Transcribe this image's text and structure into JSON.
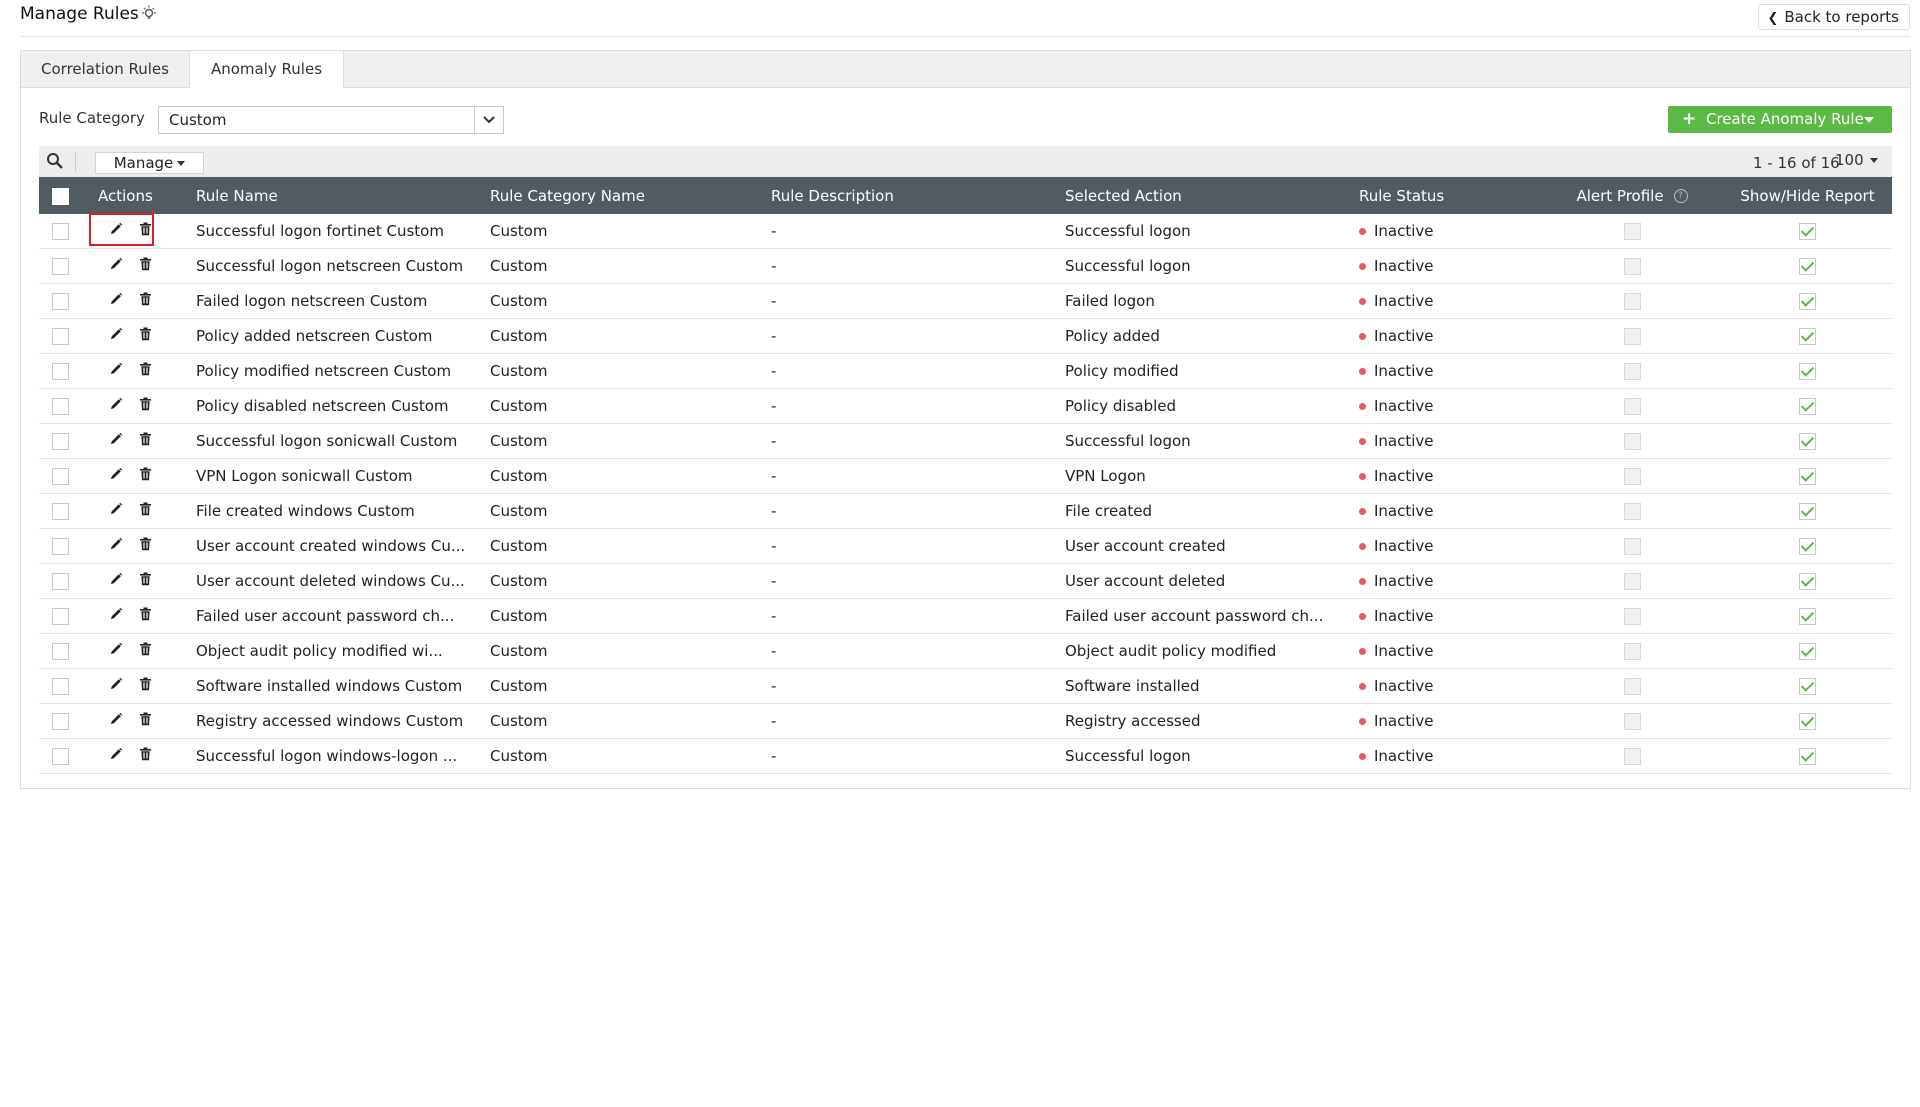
{
  "header": {
    "title": "Manage Rules",
    "bulb_icon": "lightbulb-icon",
    "back_label": "Back to reports"
  },
  "tabs": [
    {
      "label": "Correlation Rules",
      "active": false
    },
    {
      "label": "Anomaly Rules",
      "active": true
    }
  ],
  "filter": {
    "label": "Rule Category",
    "selected": "Custom"
  },
  "create_button": {
    "label": "Create Anomaly Rule",
    "color": "#5cb946"
  },
  "toolbar": {
    "manage_label": "Manage",
    "pager_text": "1 - 16 of 16",
    "per_page": "100"
  },
  "table": {
    "header_bg": "#515c62",
    "columns": [
      "Actions",
      "Rule Name",
      "Rule Category Name",
      "Rule Description",
      "Selected Action",
      "Rule Status",
      "Alert Profile",
      "Show/Hide Report"
    ],
    "rows": [
      {
        "name": "Successful logon fortinet Custom",
        "category": "Custom",
        "description": "-",
        "action": "Successful logon",
        "status": "Inactive"
      },
      {
        "name": "Successful logon netscreen Custom",
        "category": "Custom",
        "description": "-",
        "action": "Successful logon",
        "status": "Inactive"
      },
      {
        "name": "Failed logon netscreen Custom",
        "category": "Custom",
        "description": "-",
        "action": "Failed logon",
        "status": "Inactive"
      },
      {
        "name": "Policy added netscreen Custom",
        "category": "Custom",
        "description": "-",
        "action": "Policy added",
        "status": "Inactive"
      },
      {
        "name": "Policy modified netscreen Custom",
        "category": "Custom",
        "description": "-",
        "action": "Policy modified",
        "status": "Inactive"
      },
      {
        "name": "Policy disabled netscreen Custom",
        "category": "Custom",
        "description": "-",
        "action": "Policy disabled",
        "status": "Inactive"
      },
      {
        "name": "Successful logon sonicwall Custom",
        "category": "Custom",
        "description": "-",
        "action": "Successful logon",
        "status": "Inactive"
      },
      {
        "name": "VPN Logon sonicwall Custom",
        "category": "Custom",
        "description": "-",
        "action": "VPN Logon",
        "status": "Inactive"
      },
      {
        "name": "File created windows Custom",
        "category": "Custom",
        "description": "-",
        "action": "File created",
        "status": "Inactive"
      },
      {
        "name": "User account created windows Cu...",
        "category": "Custom",
        "description": "-",
        "action": "User account created",
        "status": "Inactive"
      },
      {
        "name": "User account deleted windows Cu...",
        "category": "Custom",
        "description": "-",
        "action": "User account deleted",
        "status": "Inactive"
      },
      {
        "name": "Failed user account password ch...",
        "category": "Custom",
        "description": "-",
        "action": "Failed user account password ch...",
        "status": "Inactive"
      },
      {
        "name": "Object audit policy modified wi...",
        "category": "Custom",
        "description": "-",
        "action": "Object audit policy modified",
        "status": "Inactive"
      },
      {
        "name": "Software installed windows Custom",
        "category": "Custom",
        "description": "-",
        "action": "Software installed",
        "status": "Inactive"
      },
      {
        "name": "Registry accessed windows Custom",
        "category": "Custom",
        "description": "-",
        "action": "Registry accessed",
        "status": "Inactive"
      },
      {
        "name": "Successful logon windows-logon ...",
        "category": "Custom",
        "description": "-",
        "action": "Successful logon",
        "status": "Inactive"
      }
    ]
  }
}
